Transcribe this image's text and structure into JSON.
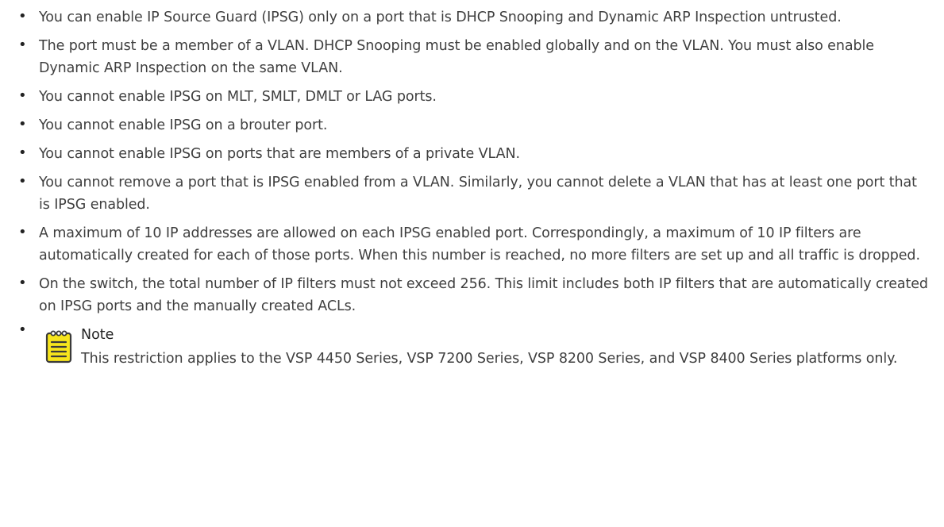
{
  "restrictions": [
    "You can enable IP Source Guard (IPSG) only on a port that is DHCP Snooping and Dynamic ARP Inspection untrusted.",
    "The port must be a member of a VLAN. DHCP Snooping must be enabled globally and on the VLAN. You must also enable Dynamic ARP Inspection on the same VLAN.",
    "You cannot enable IPSG on MLT, SMLT, DMLT or LAG ports.",
    "You cannot enable IPSG on a brouter port.",
    "You cannot enable IPSG on ports that are members of a private VLAN.",
    "You cannot remove a port that is IPSG enabled from a VLAN. Similarly, you cannot delete a VLAN that has at least one port that is IPSG enabled.",
    "A maximum of 10 IP addresses are allowed on each IPSG enabled port. Correspondingly, a maximum of 10 IP filters are automatically created for each of those ports. When this number is reached, no more filters are set up and all traffic is dropped.",
    "On the switch, the total number of IP filters must not exceed 256. This limit includes both IP filters that are automatically created on IPSG ports and the manually created ACLs."
  ],
  "note": {
    "icon": "notepad-icon",
    "title": "Note",
    "text": "This restriction applies to the VSP 4450 Series, VSP 7200 Series, VSP 8200 Series, and VSP 8400 Series platforms only."
  },
  "colors": {
    "text": "#3f3f3f",
    "note_icon_fill": "#f7e51c",
    "note_icon_stroke": "#3a3a3a"
  }
}
